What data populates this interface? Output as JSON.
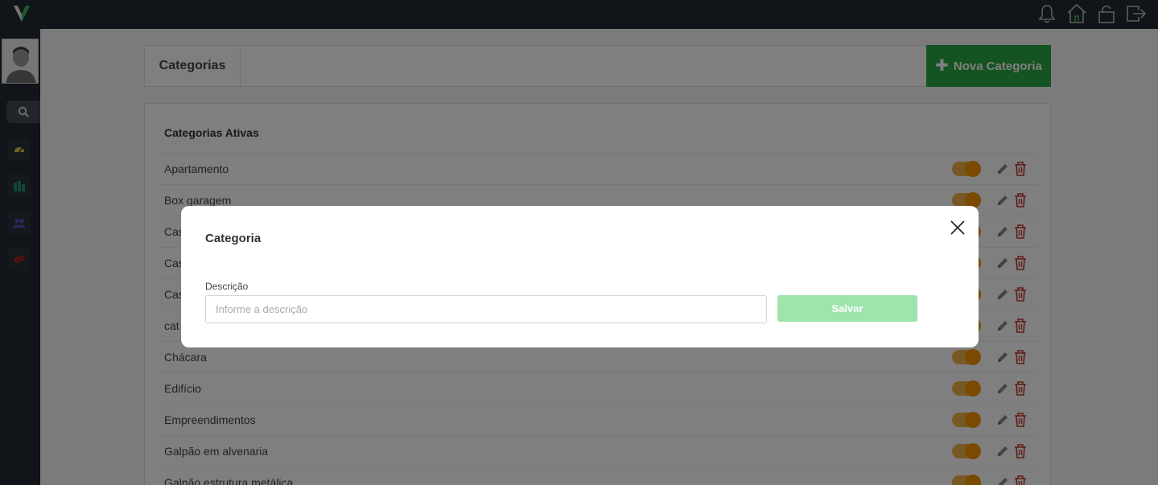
{
  "header": {
    "title": "Categorias",
    "new_button_label": "Nova Categoria"
  },
  "list": {
    "title": "Categorias Ativas",
    "items": [
      {
        "label": "Apartamento"
      },
      {
        "label": "Box garagem"
      },
      {
        "label": "Cas"
      },
      {
        "label": "Cas"
      },
      {
        "label": "Cas"
      },
      {
        "label": "cat"
      },
      {
        "label": "Chácara"
      },
      {
        "label": "Edifício"
      },
      {
        "label": "Empreendimentos"
      },
      {
        "label": "Galpão em alvenaria"
      },
      {
        "label": "Galpão estrutura metálica"
      }
    ]
  },
  "modal": {
    "title": "Categoria",
    "field_label": "Descrição",
    "field_placeholder": "Informe a descrição",
    "field_value": "",
    "save_label": "Salvar"
  },
  "icons": {
    "logo": "v-logo",
    "top": [
      "bell-icon",
      "home-icon",
      "lock-icon",
      "logout-icon"
    ],
    "sidebar": [
      "search-icon",
      "dashboard-icon",
      "building-icon",
      "users-icon",
      "settings-icon"
    ]
  },
  "colors": {
    "accent": "#28a745",
    "toggle_on": "#f29400",
    "delete": "#c0392b",
    "save_disabled": "#9ee4ad",
    "sidebar": "#222931"
  }
}
